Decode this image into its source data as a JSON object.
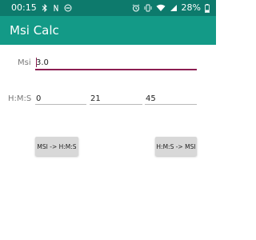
{
  "status_bar": {
    "time": "00:15",
    "battery_percent": "28%",
    "left_icons": [
      "bluetooth-icon",
      "nfc-icon",
      "do-not-disturb-icon"
    ],
    "right_icons": [
      "alarm-icon",
      "vibrate-icon",
      "wifi-icon",
      "signal-icon",
      "battery-icon"
    ]
  },
  "app_bar": {
    "title": "Msi Calc"
  },
  "form": {
    "msi_label": "Msi",
    "msi_value": "3.0",
    "hms_label": "H:M:S",
    "hours_value": "0",
    "minutes_value": "21",
    "seconds_value": "45"
  },
  "buttons": {
    "msi_to_hms": "MSI -> H:M:S",
    "hms_to_msi": "H:M:S -> MSI"
  },
  "colors": {
    "status_bar": "#0d7a6c",
    "app_bar": "#139a87",
    "accent": "#8c1e52"
  }
}
